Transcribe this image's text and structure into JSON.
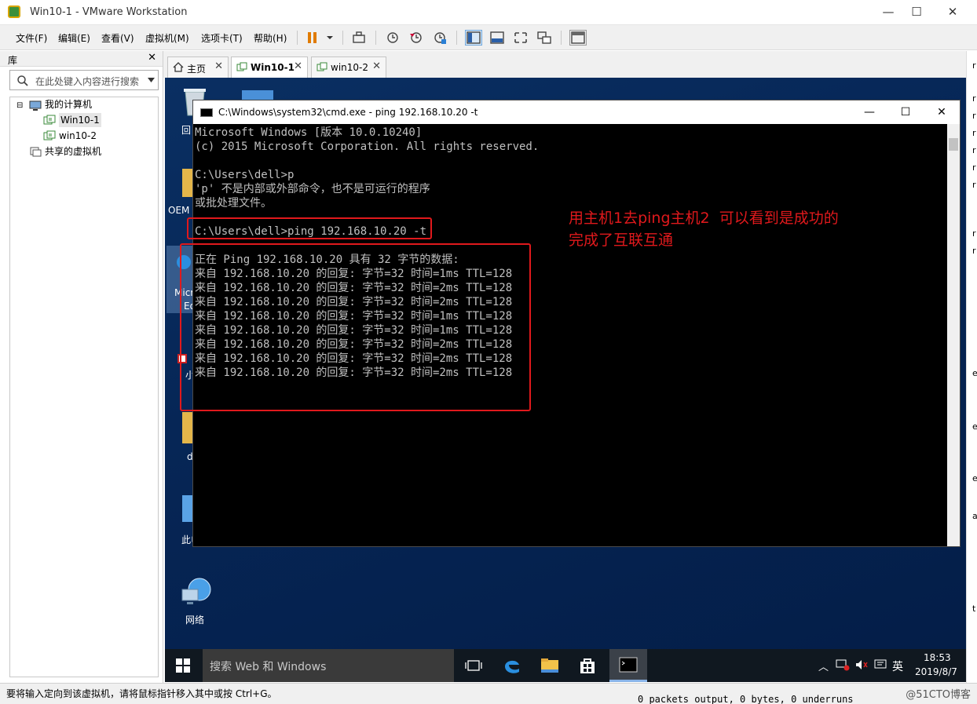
{
  "window": {
    "title": "Win10-1 - VMware Workstation",
    "minimize": "—",
    "maximize": "☐",
    "close": "✕"
  },
  "menu": [
    "文件(F)",
    "编辑(E)",
    "查看(V)",
    "虚拟机(M)",
    "选项卡(T)",
    "帮助(H)"
  ],
  "library": {
    "title": "库",
    "close": "✕",
    "search_placeholder": "在此处键入内容进行搜索",
    "tree": {
      "root": "我的计算机",
      "vms": [
        "Win10-1",
        "win10-2"
      ],
      "shared": "共享的虚拟机"
    }
  },
  "tabs": [
    {
      "label": "主页",
      "close": "✕"
    },
    {
      "label": "Win10-1",
      "close": "✕",
      "active": true
    },
    {
      "label": "win10-2",
      "close": "✕"
    }
  ],
  "desktop": {
    "icons": [
      "回",
      "OEM",
      "Micr",
      "Ed",
      "小",
      "d",
      "此电",
      "网络"
    ]
  },
  "cmd": {
    "title": "C:\\Windows\\system32\\cmd.exe - ping  192.168.10.20 -t",
    "lines": [
      "Microsoft Windows [版本 10.0.10240]",
      "(c) 2015 Microsoft Corporation. All rights reserved.",
      "",
      "C:\\Users\\dell>p",
      "'p' 不是内部或外部命令，也不是可运行的程序",
      "或批处理文件。",
      "",
      "C:\\Users\\dell>ping 192.168.10.20 -t",
      "",
      "正在 Ping 192.168.10.20 具有 32 字节的数据:",
      "来自 192.168.10.20 的回复: 字节=32 时间=1ms TTL=128",
      "来自 192.168.10.20 的回复: 字节=32 时间=2ms TTL=128",
      "来自 192.168.10.20 的回复: 字节=32 时间=2ms TTL=128",
      "来自 192.168.10.20 的回复: 字节=32 时间=1ms TTL=128",
      "来自 192.168.10.20 的回复: 字节=32 时间=1ms TTL=128",
      "来自 192.168.10.20 的回复: 字节=32 时间=2ms TTL=128",
      "来自 192.168.10.20 的回复: 字节=32 时间=2ms TTL=128",
      "来自 192.168.10.20 的回复: 字节=32 时间=2ms TTL=128"
    ]
  },
  "annotation": "用主机1去ping主机2  可以看到是成功的\n完成了互联互通",
  "taskbar": {
    "search": "搜索 Web 和 Windows",
    "ime": "英",
    "time": "18:53",
    "date": "2019/8/7"
  },
  "rightstrip": [
    "r",
    "r",
    "r",
    "r",
    "r",
    "r",
    "r",
    "r",
    "r",
    "e",
    "e",
    "e",
    "a",
    "t"
  ],
  "status": {
    "message": "要将输入定向到该虚拟机，请将鼠标指针移入其中或按 Ctrl+G。",
    "behind": "0 packets output, 0 bytes, 0 underruns",
    "watermark": "@51CTO博客"
  },
  "colors": {
    "annotation": "#e0191c",
    "desktop": "#062656",
    "taskbar": "#101820"
  }
}
